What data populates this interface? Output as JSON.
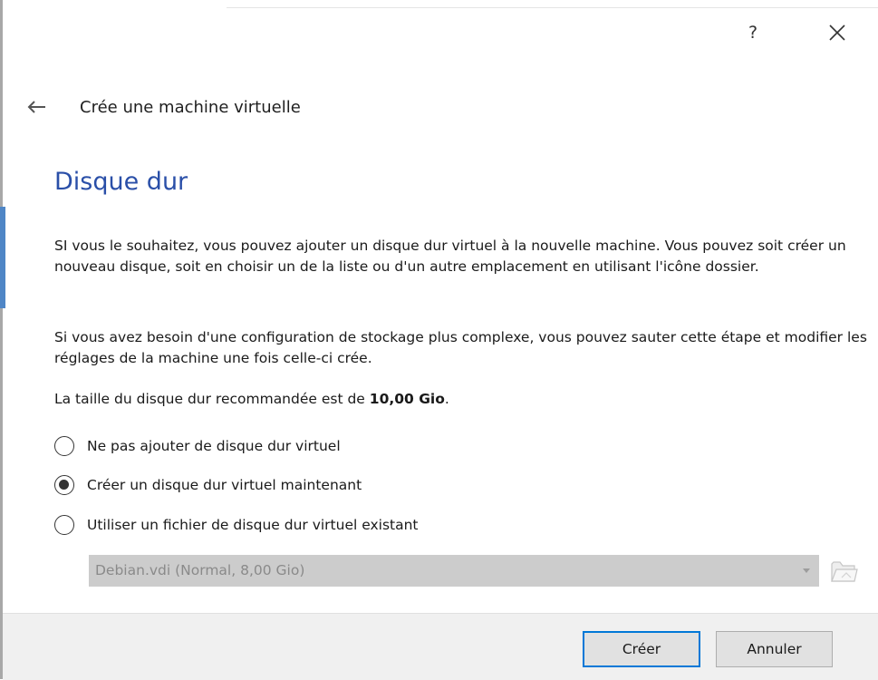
{
  "window": {
    "help_label": "?",
    "close_icon": "close-icon",
    "back_icon": "back-arrow-icon",
    "wizard_title": "Crée une machine virtuelle"
  },
  "page": {
    "title": "Disque dur",
    "paragraph1": "SI vous le souhaitez, vous pouvez ajouter un disque dur virtuel à la nouvelle machine. Vous pouvez soit créer un nouveau disque, soit en choisir un de la liste ou d'un autre emplacement en utilisant l'icône dossier.",
    "paragraph2": "Si vous avez besoin d'une configuration de stockage plus complexe, vous pouvez sauter cette étape et modifier les réglages de la machine une fois celle-ci crée.",
    "recommended_prefix": "La taille du disque dur recommandée est de ",
    "recommended_size": "10,00 Gio",
    "recommended_suffix": "."
  },
  "options": [
    {
      "label": "Ne pas ajouter de disque dur virtuel",
      "checked": false
    },
    {
      "label": "Créer un disque dur virtuel maintenant",
      "checked": true
    },
    {
      "label": "Utiliser un fichier de disque dur virtuel existant",
      "checked": false
    }
  ],
  "existing_disk": {
    "selected": "Debian.vdi (Normal, 8,00 Gio)",
    "enabled": false,
    "folder_icon": "folder-icon"
  },
  "buttons": {
    "create": "Créer",
    "cancel": "Annuler"
  },
  "colors": {
    "title": "#2a4fa8",
    "accent": "#0078d7",
    "disabled_field": "#cccccc"
  }
}
